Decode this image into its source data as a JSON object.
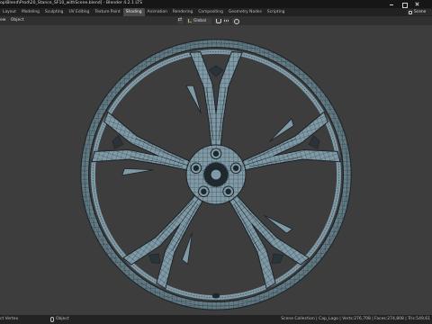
{
  "window": {
    "title": "op\\Blend\\Prod\\20_Stance_SF10_withScene.blend] - Blender 4.2.1 LTS"
  },
  "workspaces": {
    "tabs": [
      {
        "label": "Layout",
        "active": false
      },
      {
        "label": "Modeling",
        "active": false
      },
      {
        "label": "Sculpting",
        "active": false
      },
      {
        "label": "UV Editing",
        "active": false
      },
      {
        "label": "Texture Paint",
        "active": false
      },
      {
        "label": "Shading",
        "active": true
      },
      {
        "label": "Animation",
        "active": false
      },
      {
        "label": "Rendering",
        "active": false
      },
      {
        "label": "Compositing",
        "active": false
      },
      {
        "label": "Geometry Nodes",
        "active": false
      },
      {
        "label": "Scripting",
        "active": false
      }
    ],
    "scene_label": "Scene"
  },
  "header": {
    "menus": [
      "ew",
      "Object"
    ],
    "orientation": "Global"
  },
  "viewport": {
    "object_color": "#7f9aa6",
    "wire_color": "#1a2226",
    "background_color": "#3d3d3d"
  },
  "statusbar": {
    "left": "ct Vertex",
    "mid": "Object",
    "right": "Scene Collection | Cap_Logo | Verts:276,708 | Faces:274,808 | Tris:549,61"
  }
}
